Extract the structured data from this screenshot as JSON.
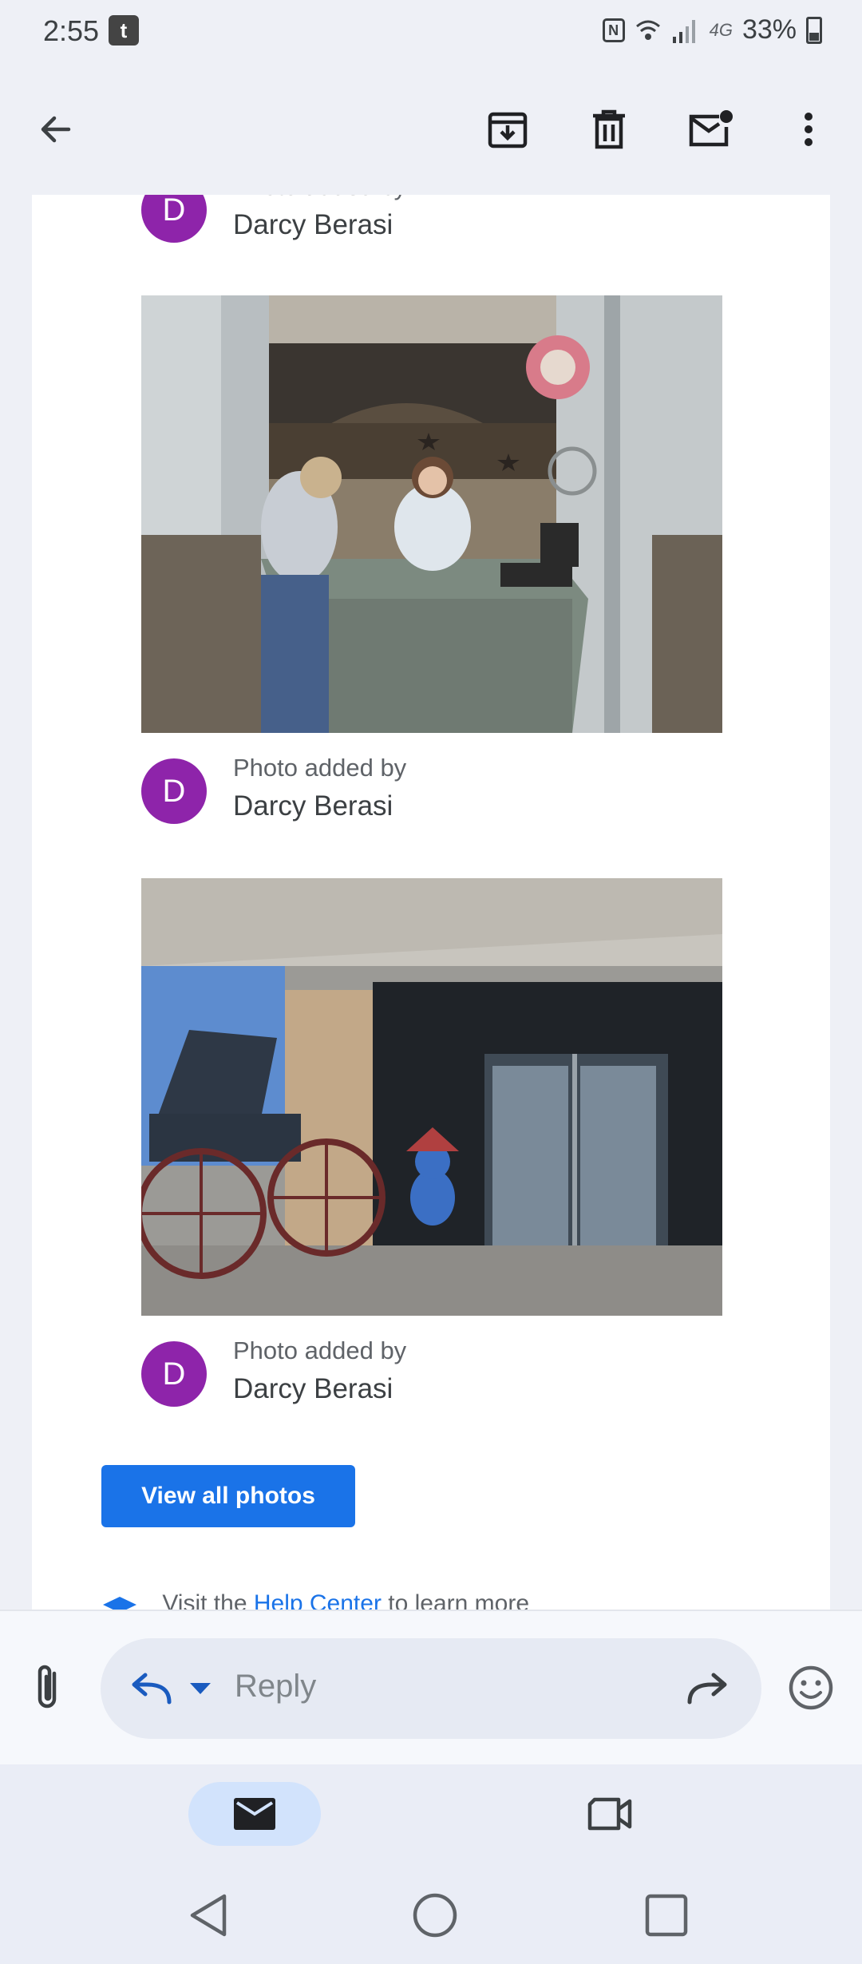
{
  "status_bar": {
    "time": "2:55",
    "app_icon_glyph": "t",
    "nfc_glyph": "N",
    "network": "4G",
    "battery": "33%"
  },
  "toolbar": {
    "icons": [
      "back-arrow-icon",
      "archive-icon",
      "delete-icon",
      "mark-unread-icon",
      "more-vert-icon"
    ]
  },
  "photos": [
    {
      "caption": "Photo added by",
      "author": "Darcy Berasi",
      "avatar_initial": "D"
    },
    {
      "caption": "Photo added by",
      "author": "Darcy Berasi",
      "avatar_initial": "D"
    },
    {
      "caption": "Photo added by",
      "author": "Darcy Berasi",
      "avatar_initial": "D"
    }
  ],
  "view_all_label": "View all photos",
  "help": {
    "prefix": "Visit the ",
    "link": "Help Center",
    "suffix": " to learn more"
  },
  "reply": {
    "placeholder": "Reply"
  },
  "colors": {
    "accent": "#1a73e8",
    "avatar": "#8e24aa",
    "background": "#eef0f6"
  }
}
